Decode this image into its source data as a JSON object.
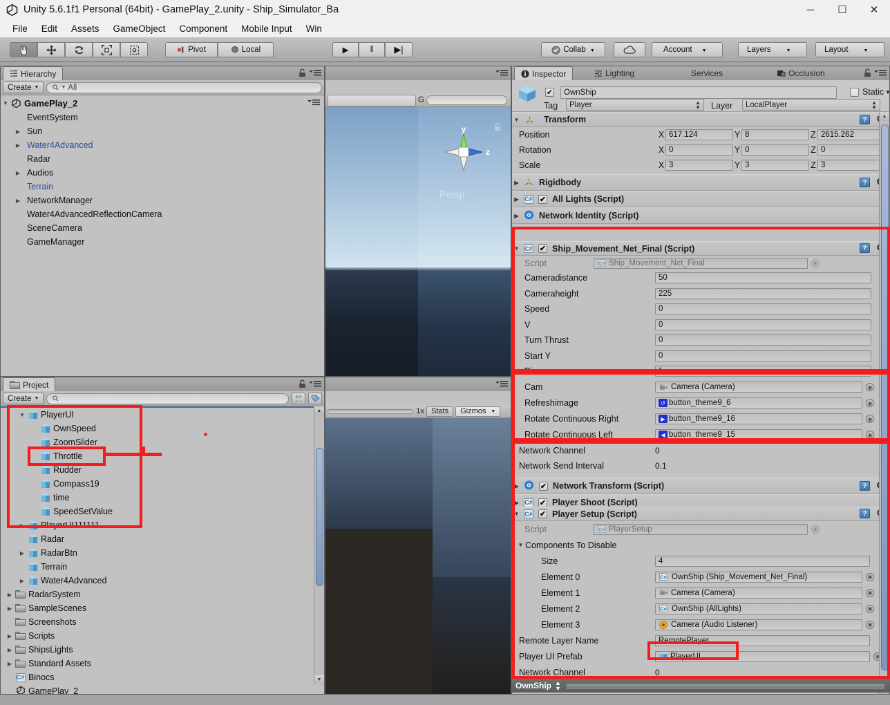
{
  "window": {
    "title": "Unity 5.6.1f1 Personal (64bit) - GamePlay_2.unity - Ship_Simulator_Ba",
    "minimize": "─",
    "maximize": "☐",
    "close": "✕"
  },
  "menu": [
    "File",
    "Edit",
    "Assets",
    "GameObject",
    "Component",
    "Mobile Input",
    "Win"
  ],
  "toolbar": {
    "tools": [
      "hand-tool",
      "move-tool",
      "rotate-tool",
      "scale-tool",
      "rect-tool"
    ],
    "pivot_label": "Pivot",
    "local_label": "Local",
    "play": "▶",
    "pause": "‖",
    "step": "▶|",
    "collab_label": "Collab",
    "cloud_label": "",
    "account_label": "Account",
    "layers_label": "Layers",
    "layout_label": "Layout"
  },
  "hierarchy": {
    "tab_label": "Hierarchy",
    "create_label": "Create",
    "search_placeholder": "All",
    "root": "GamePlay_2",
    "items": [
      {
        "label": "EventSystem",
        "arrow": false,
        "blue": false,
        "indent": 1
      },
      {
        "label": "Sun",
        "arrow": true,
        "blue": false,
        "indent": 1
      },
      {
        "label": "Water4Advanced",
        "arrow": true,
        "blue": true,
        "indent": 1
      },
      {
        "label": "Radar",
        "arrow": false,
        "blue": false,
        "indent": 1
      },
      {
        "label": "Audios",
        "arrow": true,
        "blue": false,
        "indent": 1
      },
      {
        "label": "Terrain",
        "arrow": false,
        "blue": true,
        "indent": 1
      },
      {
        "label": "NetworkManager",
        "arrow": true,
        "blue": false,
        "indent": 1
      },
      {
        "label": "Water4AdvancedReflectionCamera",
        "arrow": false,
        "blue": false,
        "indent": 1
      },
      {
        "label": "SceneCamera",
        "arrow": false,
        "blue": false,
        "indent": 1
      },
      {
        "label": "GameManager",
        "arrow": false,
        "blue": false,
        "indent": 1
      }
    ]
  },
  "project": {
    "tab_label": "Project",
    "create_label": "Create",
    "search_placeholder": "",
    "items": [
      {
        "label": "PlayerUI",
        "arrow": "down",
        "icon": "cube",
        "indent": 1
      },
      {
        "label": "OwnSpeed",
        "arrow": "",
        "icon": "cube",
        "indent": 2
      },
      {
        "label": "ZoomSlider",
        "arrow": "",
        "icon": "cube",
        "indent": 2
      },
      {
        "label": "Throttle",
        "arrow": "",
        "icon": "cube",
        "indent": 2
      },
      {
        "label": "Rudder",
        "arrow": "",
        "icon": "cube",
        "indent": 2
      },
      {
        "label": "Compass19",
        "arrow": "",
        "icon": "cube",
        "indent": 2
      },
      {
        "label": "time",
        "arrow": "",
        "icon": "cube",
        "indent": 2
      },
      {
        "label": "SpeedSetValue",
        "arrow": "",
        "icon": "cube",
        "indent": 2
      },
      {
        "label": "PlayerUI111111",
        "arrow": "right",
        "icon": "cube",
        "indent": 1
      },
      {
        "label": "Radar",
        "arrow": "",
        "icon": "cube",
        "indent": 1
      },
      {
        "label": "RadarBtn",
        "arrow": "right",
        "icon": "cube",
        "indent": 1
      },
      {
        "label": "Terrain",
        "arrow": "",
        "icon": "cube",
        "indent": 1
      },
      {
        "label": "Water4Advanced",
        "arrow": "right",
        "icon": "cube",
        "indent": 1
      },
      {
        "label": "RadarSystem",
        "arrow": "right",
        "icon": "folder",
        "indent": 0
      },
      {
        "label": "SampleScenes",
        "arrow": "right",
        "icon": "folder",
        "indent": 0
      },
      {
        "label": "Screenshots",
        "arrow": "",
        "icon": "folder",
        "indent": 0
      },
      {
        "label": "Scripts",
        "arrow": "right",
        "icon": "folder",
        "indent": 0
      },
      {
        "label": "ShipsLights",
        "arrow": "right",
        "icon": "folder",
        "indent": 0
      },
      {
        "label": "Standard Assets",
        "arrow": "right",
        "icon": "folder",
        "indent": 0
      },
      {
        "label": "Binocs",
        "arrow": "",
        "icon": "cs",
        "indent": 0
      },
      {
        "label": "GamePlay_2",
        "arrow": "",
        "icon": "unity",
        "indent": 0
      }
    ]
  },
  "scene_view": {
    "gizmo": {
      "y_label": "y",
      "z_label": "z",
      "persp_label": "Persp"
    }
  },
  "game_view": {
    "scale_label": "1x",
    "stats_label": "Stats",
    "gizmos_label": "Gizmos"
  },
  "inspector": {
    "tabs": [
      {
        "label": "Inspector",
        "active": true
      },
      {
        "label": "Lighting",
        "active": false
      },
      {
        "label": "Services",
        "active": false
      },
      {
        "label": "Occlusion",
        "active": false
      }
    ],
    "object_name": "OwnShip",
    "static_label": "Static",
    "tag_label": "Tag",
    "tag_value": "Player",
    "layer_label": "Layer",
    "layer_value": "LocalPlayer",
    "transform": {
      "title": "Transform",
      "rows": [
        {
          "label": "Position",
          "x": "617.124",
          "y": "8",
          "z": "2615.262"
        },
        {
          "label": "Rotation",
          "x": "0",
          "y": "0",
          "z": "0"
        },
        {
          "label": "Scale",
          "x": "3",
          "y": "3",
          "z": "3"
        }
      ],
      "axis": [
        "X",
        "Y",
        "Z"
      ]
    },
    "components": [
      {
        "title": "Rigidbody",
        "checkbox": false,
        "expanded": false,
        "icon": "transform"
      },
      {
        "title": "All Lights (Script)",
        "checkbox": true,
        "expanded": false,
        "icon": "cs"
      },
      {
        "title": "Network Identity (Script)",
        "checkbox": false,
        "expanded": false,
        "icon": "net"
      }
    ],
    "ship_movement": {
      "title": "Ship_Movement_Net_Final (Script)",
      "script_label": "Script",
      "script_value": "Ship_Movement_Net_Final",
      "fields": [
        {
          "label": "Cameradistance",
          "value": "50"
        },
        {
          "label": "Cameraheight",
          "value": "225"
        },
        {
          "label": "Speed",
          "value": "0"
        },
        {
          "label": "V",
          "value": "0"
        },
        {
          "label": "Turn Thrust",
          "value": "0"
        },
        {
          "label": "Start Y",
          "value": "0"
        },
        {
          "label": "Dire",
          "value": "1"
        }
      ],
      "obj_fields": [
        {
          "label": "Cam",
          "value": "Camera (Camera)",
          "icon": "camera"
        },
        {
          "label": "Refreshimage",
          "value": "button_theme9_6",
          "icon": "sprite-refresh"
        },
        {
          "label": "Rotate Continuous Right",
          "value": "button_theme9_16",
          "icon": "sprite-right"
        },
        {
          "label": "Rotate Continuous Left",
          "value": "button_theme9_15",
          "icon": "sprite-left"
        }
      ],
      "net_rows": [
        {
          "label": "Network Channel",
          "value": "0"
        },
        {
          "label": "Network Send Interval",
          "value": "0.1"
        }
      ]
    },
    "more_components": [
      {
        "title": "Network Transform (Script)",
        "checkbox": true,
        "expanded": false,
        "icon": "net"
      },
      {
        "title": "Player Shoot (Script)",
        "checkbox": true,
        "expanded": false,
        "icon": "cs"
      }
    ],
    "player_setup": {
      "title": "Player Setup (Script)",
      "script_label": "Script",
      "script_value": "PlayerSetup",
      "array_label": "Components To Disable",
      "size_label": "Size",
      "size_value": "4",
      "elements": [
        {
          "label": "Element 0",
          "value": "OwnShip (Ship_Movement_Net_Final)",
          "icon": "cs"
        },
        {
          "label": "Element 1",
          "value": "Camera (Camera)",
          "icon": "camera"
        },
        {
          "label": "Element 2",
          "value": "OwnShip (AllLights)",
          "icon": "cs"
        },
        {
          "label": "Element 3",
          "value": "Camera (Audio Listener)",
          "icon": "audio"
        }
      ],
      "remote_layer_label": "Remote Layer Name",
      "remote_layer_value": "RemotePlayer",
      "prefab_label": "Player UI Prefab",
      "prefab_value": "PlayerUI",
      "channel_label": "Network Channel",
      "channel_value": "0"
    },
    "footer_label": "OwnShip"
  },
  "annotation_color": "#f41c1c"
}
